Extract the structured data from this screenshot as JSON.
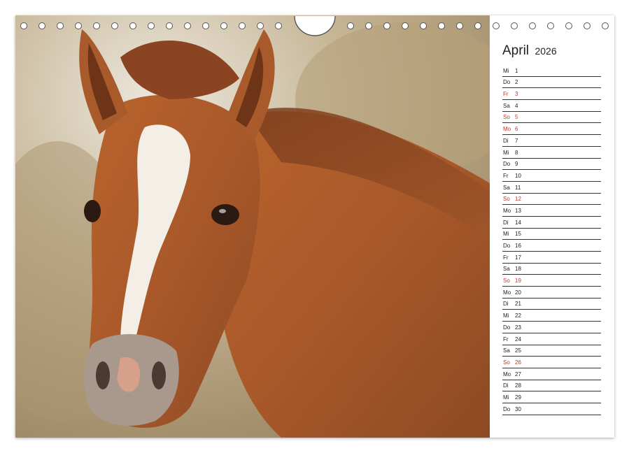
{
  "calendar": {
    "month": "April",
    "year": "2026",
    "days": [
      {
        "wd": "Mi",
        "num": "1",
        "holiday": false
      },
      {
        "wd": "Do",
        "num": "2",
        "holiday": false
      },
      {
        "wd": "Fr",
        "num": "3",
        "holiday": true
      },
      {
        "wd": "Sa",
        "num": "4",
        "holiday": false
      },
      {
        "wd": "So",
        "num": "5",
        "holiday": true
      },
      {
        "wd": "Mo",
        "num": "6",
        "holiday": true
      },
      {
        "wd": "Di",
        "num": "7",
        "holiday": false
      },
      {
        "wd": "Mi",
        "num": "8",
        "holiday": false
      },
      {
        "wd": "Do",
        "num": "9",
        "holiday": false
      },
      {
        "wd": "Fr",
        "num": "10",
        "holiday": false
      },
      {
        "wd": "Sa",
        "num": "11",
        "holiday": false
      },
      {
        "wd": "So",
        "num": "12",
        "holiday": true
      },
      {
        "wd": "Mo",
        "num": "13",
        "holiday": false
      },
      {
        "wd": "Di",
        "num": "14",
        "holiday": false
      },
      {
        "wd": "Mi",
        "num": "15",
        "holiday": false
      },
      {
        "wd": "Do",
        "num": "16",
        "holiday": false
      },
      {
        "wd": "Fr",
        "num": "17",
        "holiday": false
      },
      {
        "wd": "Sa",
        "num": "18",
        "holiday": false
      },
      {
        "wd": "So",
        "num": "19",
        "holiday": true
      },
      {
        "wd": "Mo",
        "num": "20",
        "holiday": false
      },
      {
        "wd": "Di",
        "num": "21",
        "holiday": false
      },
      {
        "wd": "Mi",
        "num": "22",
        "holiday": false
      },
      {
        "wd": "Do",
        "num": "23",
        "holiday": false
      },
      {
        "wd": "Fr",
        "num": "24",
        "holiday": false
      },
      {
        "wd": "Sa",
        "num": "25",
        "holiday": false
      },
      {
        "wd": "So",
        "num": "26",
        "holiday": true
      },
      {
        "wd": "Mo",
        "num": "27",
        "holiday": false
      },
      {
        "wd": "Di",
        "num": "28",
        "holiday": false
      },
      {
        "wd": "Mi",
        "num": "29",
        "holiday": false
      },
      {
        "wd": "Do",
        "num": "30",
        "holiday": false
      }
    ]
  },
  "colors": {
    "holiday": "#c0392b",
    "text": "#222222",
    "coat": "#a85a2a"
  },
  "photo_subject": "chestnut-foal-with-white-blaze"
}
